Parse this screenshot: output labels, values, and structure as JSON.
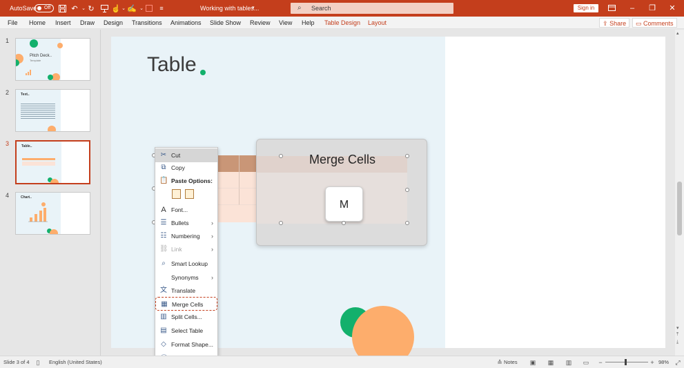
{
  "titlebar": {
    "autosave_label": "AutoSave",
    "autosave_state": "Off",
    "doc_title": "Working with tables...",
    "search_placeholder": "Search",
    "signin_label": "Sign in",
    "brand_color": "#c43e1c"
  },
  "ribbon": {
    "tabs": [
      "File",
      "Home",
      "Insert",
      "Draw",
      "Design",
      "Transitions",
      "Animations",
      "Slide Show",
      "Review",
      "View",
      "Help",
      "Table Design",
      "Layout"
    ],
    "share_label": "Share",
    "comments_label": "Comments"
  },
  "thumbnails": [
    {
      "number": "1",
      "title": "Pitch Deck..",
      "subtitle": "Template"
    },
    {
      "number": "2",
      "title": "Text.."
    },
    {
      "number": "3",
      "title": "Table..",
      "selected": true
    },
    {
      "number": "4",
      "title": "Chart.."
    }
  ],
  "slide": {
    "title": "Table",
    "accent_green": "#13b06c",
    "accent_orange": "#fdad6c",
    "table_header_color": "#c99677"
  },
  "tooltip": {
    "title": "Merge Cells",
    "key": "M"
  },
  "context_menu": {
    "items": [
      {
        "label": "Cut",
        "icon": "scissors-icon",
        "state": "hover"
      },
      {
        "label": "Copy",
        "icon": "copy-icon"
      },
      {
        "label": "Paste Options:",
        "icon": "clipboard-icon",
        "bold": true
      },
      {
        "label": "Font...",
        "icon": "font-icon"
      },
      {
        "label": "Bullets",
        "icon": "bullets-icon",
        "submenu": true
      },
      {
        "label": "Numbering",
        "icon": "numbering-icon",
        "submenu": true
      },
      {
        "label": "Link",
        "icon": "link-icon",
        "submenu": true,
        "disabled": true
      },
      {
        "label": "Smart Lookup",
        "icon": "smart-lookup-icon"
      },
      {
        "label": "Synonyms",
        "submenu": true
      },
      {
        "label": "Translate",
        "icon": "translate-icon"
      },
      {
        "label": "Merge Cells",
        "icon": "merge-cells-icon",
        "state": "focus"
      },
      {
        "label": "Split Cells...",
        "icon": "split-cells-icon"
      },
      {
        "label": "Select Table",
        "icon": "select-table-icon"
      },
      {
        "label": "Format Shape...",
        "icon": "format-shape-icon"
      },
      {
        "label": "New Comment",
        "icon": "new-comment-icon"
      }
    ]
  },
  "statusbar": {
    "slide_info": "Slide 3 of 4",
    "language": "English (United States)",
    "notes_label": "Notes",
    "zoom": "98%"
  }
}
